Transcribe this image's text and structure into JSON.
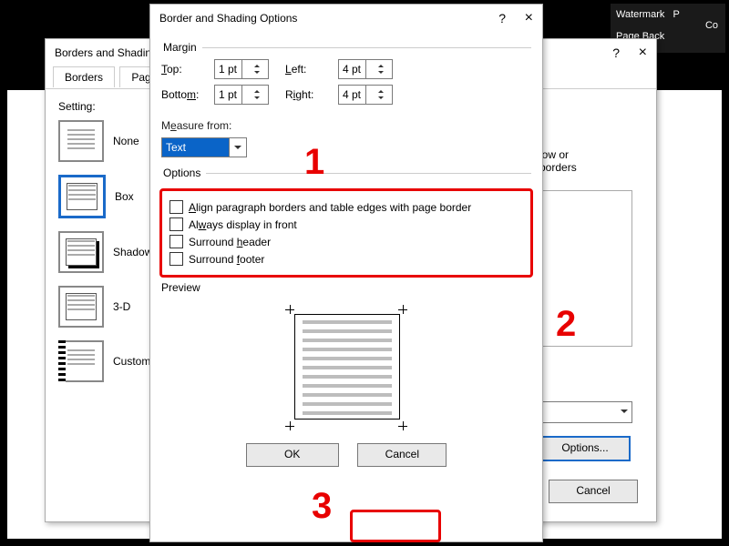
{
  "ribbon": {
    "watermark": "Watermark",
    "p": "P",
    "co": "Co",
    "pageback": "Page Back"
  },
  "dlg_back": {
    "title": "Borders and Shading",
    "tab_borders": "Borders",
    "tab_page": "Page",
    "setting": "Setting:",
    "items": [
      "None",
      "Box",
      "Shadow",
      "3-D",
      "Custom"
    ],
    "right_hint1": "low or",
    "right_hint2": "borders",
    "options_btn": "Options...",
    "cancel": "Cancel"
  },
  "dlg_front": {
    "title": "Border and Shading Options",
    "margin": "Margin",
    "top": "Top:",
    "bottom": "Bottom:",
    "left": "Left:",
    "right": "Right:",
    "top_v": "1 pt",
    "bottom_v": "1 pt",
    "left_v": "4 pt",
    "right_v": "4 pt",
    "measure_from": "Measure from:",
    "measure_sel": "Text",
    "options": "Options",
    "opt_align": "Align paragraph borders and table edges with page border",
    "opt_front": "Always display in front",
    "opt_header": "Surround header",
    "opt_footer": "Surround footer",
    "preview": "Preview",
    "ok": "OK",
    "cancel": "Cancel"
  },
  "annotations": {
    "one": "1",
    "two": "2",
    "three": "3"
  }
}
